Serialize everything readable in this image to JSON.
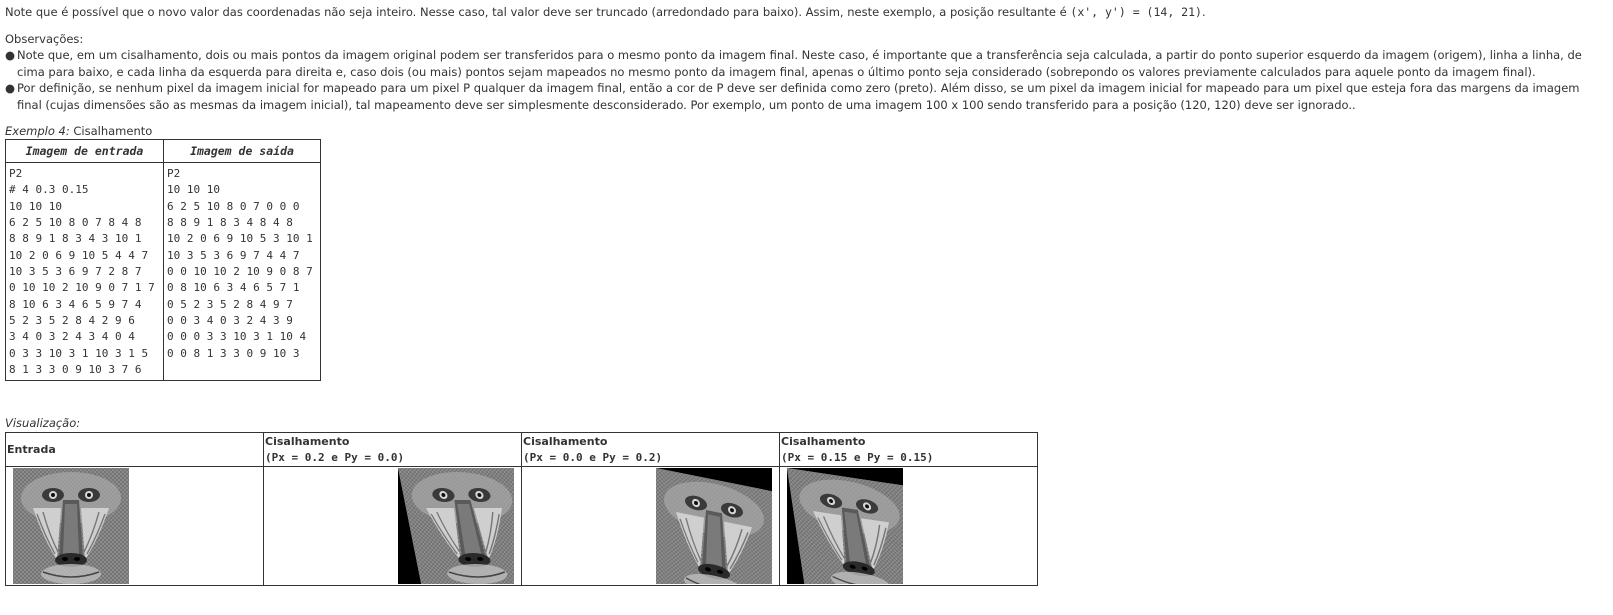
{
  "intro": {
    "text": "Note que é possível que o novo valor das coordenadas não seja inteiro. Nesse caso, tal valor deve ser truncado (arredondado para baixo). Assim, neste exemplo, a posição resultante é ",
    "code": "(x', y') = (14, 21)",
    "end": "."
  },
  "observations": {
    "title": "Observações:",
    "items": [
      "Note que, em um cisalhamento, dois ou mais pontos da imagem original podem ser transferidos para o mesmo ponto da imagem final. Neste caso, é importante que a transferência seja calculada, a partir do ponto superior esquerdo da imagem (origem), linha a linha, de cima para baixo, e cada linha da esquerda para direita e, caso dois (ou mais) pontos sejam mapeados no mesmo ponto da imagem final, apenas o último ponto seja considerado (sobrepondo os valores previamente calculados para aquele ponto da imagem final).",
      "Por definição, se nenhum pixel da imagem inicial for mapeado para um pixel P qualquer da imagem final, então a cor de P deve ser definida como zero (preto). Além disso, se um pixel da imagem inicial for mapeado para um pixel que esteja fora das margens da imagem final (cujas dimensões são as mesmas da imagem inicial), tal mapeamento deve ser simplesmente desconsiderado. Por exemplo, um ponto de uma imagem 100 x 100 sendo transferido para a posição (120, 120) deve ser ignorado.."
    ]
  },
  "example": {
    "caption_em": "Exemplo 4:",
    "caption_rest": " Cisalhamento",
    "headers": [
      "Imagem de entrada",
      "Imagem de saída"
    ],
    "input_lines": [
      "P2",
      "# 4 0.3 0.15",
      "10 10 10",
      "6 2 5 10 8 0 7 8 4 8",
      "8 8 9 1 8 3 4 3 10 1",
      "10 2 0 6 9 10 5 4 4 7",
      "10 3 5 3 6 9 7 2 8 7",
      "0 10 10 2 10 9 0 7 1 7",
      "8 10 6 3 4 6 5 9 7 4",
      "5 2 3 5 2 8 4 2 9 6",
      "3 4 0 3 2 4 3 4 0 4",
      "0 3 3 10 3 1 10 3 1 5",
      "8 1 3 3 0 9 10 3 7 6"
    ],
    "output_lines": [
      "P2",
      "10 10 10",
      "6 2 5 10 8 0 7 0 0 0",
      "8 8 9 1 8 3 4 8 4 8",
      "10 2 0 6 9 10 5 3 10 1",
      "10 3 5 3 6 9 7 4 4 7",
      "0 0 10 10 2 10 9 0 8 7",
      "0 8 10 6 3 4 6 5 7 1",
      "0 5 2 3 5 2 8 4 9 7",
      "0 0 3 4 0 3 2 4 3 9",
      "0 0 0 3 3 10 3 1 10 4",
      "0 0 8 1 3 3 0 9 10 3"
    ]
  },
  "visualization": {
    "caption": "Visualização:",
    "columns": [
      {
        "title": "Entrada",
        "params": "",
        "image": "mandrill-original"
      },
      {
        "title": "Cisalhamento",
        "params": "(Px = 0.2 e Py = 0.0)",
        "image": "mandrill-shear-x"
      },
      {
        "title": "Cisalhamento",
        "params": "(Px = 0.0 e Py = 0.2)",
        "image": "mandrill-shear-y"
      },
      {
        "title": "Cisalhamento",
        "params": "(Px = 0.15 e Py = 0.15)",
        "image": "mandrill-shear-xy"
      }
    ]
  }
}
